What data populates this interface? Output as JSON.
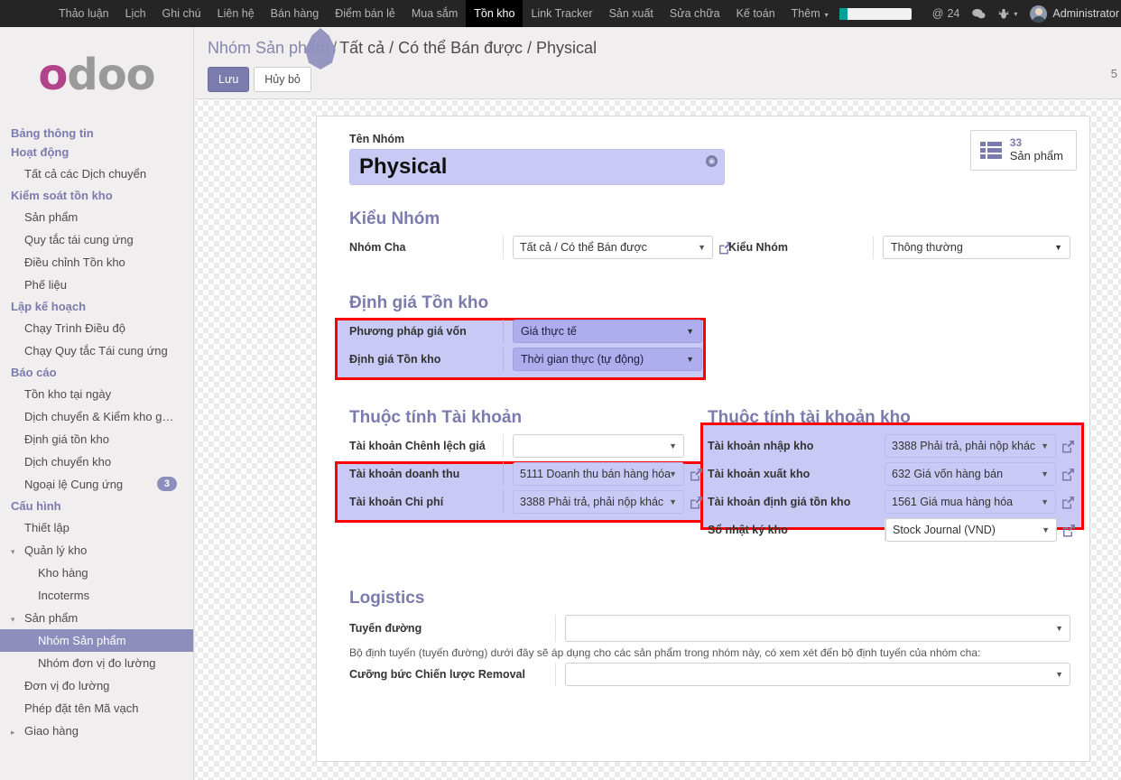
{
  "navbar": {
    "apps": [
      {
        "label": "Thảo luận",
        "active": false
      },
      {
        "label": "Lịch",
        "active": false
      },
      {
        "label": "Ghi chú",
        "active": false
      },
      {
        "label": "Liên hệ",
        "active": false
      },
      {
        "label": "Bán hàng",
        "active": false
      },
      {
        "label": "Điểm bán lẻ",
        "active": false
      },
      {
        "label": "Mua sắm",
        "active": false
      },
      {
        "label": "Tồn kho",
        "active": true
      },
      {
        "label": "Link Tracker",
        "active": false
      },
      {
        "label": "Sản xuất",
        "active": false
      },
      {
        "label": "Sửa chữa",
        "active": false
      },
      {
        "label": "Kế toán",
        "active": false
      },
      {
        "label": "Thêm",
        "active": false,
        "caret": "▾"
      }
    ],
    "systray": {
      "progress_percent": 12,
      "mention_icon": "at-icon",
      "mention_label": "@",
      "mention_count": "24",
      "chat_icon": "chat-bubble-icon",
      "chat_glyph": "💬",
      "debug_icon": "bug-icon",
      "debug_glyph": "🐞",
      "debug_caret": "▾",
      "avatar_icon": "avatar",
      "user_name": "Administrator"
    }
  },
  "sidebar": {
    "logo": {
      "first": "o",
      "rest": "doo"
    },
    "groups": [
      {
        "title": "Bảng thông tin",
        "title2": "Hoạt động",
        "items": [
          {
            "label": "Tất cả các Dịch chuyển",
            "level": 1,
            "selected": false,
            "twist": "",
            "badge": ""
          }
        ]
      },
      {
        "title": "Kiểm soát tồn kho",
        "items": [
          {
            "label": "Sản phẩm",
            "level": 1,
            "selected": false,
            "twist": "",
            "badge": ""
          },
          {
            "label": "Quy tắc tái cung ứng",
            "level": 1,
            "selected": false,
            "twist": "",
            "badge": ""
          },
          {
            "label": "Điều chỉnh Tồn kho",
            "level": 1,
            "selected": false,
            "twist": "",
            "badge": ""
          },
          {
            "label": "Phế liệu",
            "level": 1,
            "selected": false,
            "twist": "",
            "badge": ""
          }
        ]
      },
      {
        "title": "Lập kế hoạch",
        "items": [
          {
            "label": "Chạy Trình Điều độ",
            "level": 1,
            "selected": false,
            "twist": "",
            "badge": ""
          },
          {
            "label": "Chạy Quy tắc Tái cung ứng",
            "level": 1,
            "selected": false,
            "twist": "",
            "badge": ""
          }
        ]
      },
      {
        "title": "Báo cáo",
        "items": [
          {
            "label": "Tồn kho tại ngày",
            "level": 1,
            "selected": false,
            "twist": "",
            "badge": ""
          },
          {
            "label": "Dịch chuyển & Kiểm kho g…",
            "level": 1,
            "selected": false,
            "twist": "",
            "badge": ""
          },
          {
            "label": "Định giá tồn kho",
            "level": 1,
            "selected": false,
            "twist": "",
            "badge": ""
          },
          {
            "label": "Dịch chuyển kho",
            "level": 1,
            "selected": false,
            "twist": "",
            "badge": ""
          },
          {
            "label": "Ngoại lệ Cung ứng",
            "level": 1,
            "selected": false,
            "twist": "",
            "badge": "3"
          }
        ]
      },
      {
        "title": "Cấu hình",
        "items": [
          {
            "label": "Thiết lập",
            "level": 1,
            "selected": false,
            "twist": "",
            "badge": ""
          },
          {
            "label": "Quản lý kho",
            "level": 1,
            "selected": false,
            "twist": "▾",
            "badge": ""
          },
          {
            "label": "Kho hàng",
            "level": 2,
            "selected": false,
            "twist": "",
            "badge": ""
          },
          {
            "label": "Incoterms",
            "level": 2,
            "selected": false,
            "twist": "",
            "badge": ""
          },
          {
            "label": "Sản phẩm",
            "level": 1,
            "selected": false,
            "twist": "▾",
            "badge": ""
          },
          {
            "label": "Nhóm Sản phẩm",
            "level": 2,
            "selected": true,
            "twist": "",
            "badge": ""
          },
          {
            "label": "Nhóm đơn vị đo lường",
            "level": 2,
            "selected": false,
            "twist": "",
            "badge": ""
          },
          {
            "label": "Đơn vị đo lường",
            "level": 1,
            "selected": false,
            "twist": "",
            "badge": ""
          },
          {
            "label": "Phép đặt tên Mã vạch",
            "level": 1,
            "selected": false,
            "twist": "",
            "badge": ""
          },
          {
            "label": "Giao hàng",
            "level": 1,
            "selected": false,
            "twist": "▸",
            "badge": ""
          }
        ]
      }
    ]
  },
  "control_panel": {
    "breadcrumb_root": "Nhóm Sản phẩm",
    "breadcrumb_sep": "/",
    "breadcrumb_current": "Tất cả / Có thể Bán được / Physical",
    "save_label": "Lưu",
    "discard_label": "Hủy bỏ",
    "pager": "5"
  },
  "form": {
    "title_label": "Tên Nhóm",
    "title_value": "Physical",
    "title_globe_icon": "globe-translate-icon",
    "stat_button": {
      "icon": "list-icon",
      "value": "33",
      "text": "Sản phẩm"
    },
    "group_type": {
      "title": "Kiểu Nhóm",
      "parent_label": "Nhóm Cha",
      "parent_value": "Tất cả / Có thể Bán được",
      "type_label": "Kiểu Nhóm",
      "type_value": "Thông thường"
    },
    "inventory_valuation": {
      "title": "Định giá Tồn kho",
      "costing_label": "Phương pháp giá vốn",
      "costing_value": "Giá thực tế",
      "valuation_label": "Định giá Tồn kho",
      "valuation_value": "Thời gian thực (tự động)"
    },
    "account_props": {
      "title": "Thuộc tính Tài khoản",
      "price_diff_label": "Tài khoản Chênh lệch giá",
      "price_diff_value": "",
      "income_label": "Tài khoản doanh thu",
      "income_value": "5111 Doanh thu bán hàng hóa",
      "expense_label": "Tài khoản Chi phí",
      "expense_value": "3388 Phải trả, phải nộp khác"
    },
    "stock_account_props": {
      "title": "Thuộc tính tài khoản kho",
      "input_label": "Tài khoản nhập kho",
      "input_value": "3388 Phải trả, phải nộp khác",
      "output_label": "Tài khoản xuất kho",
      "output_value": "632 Giá vốn hàng bán",
      "valuation_label": "Tài khoản định giá tồn kho",
      "valuation_value": "1561 Giá mua hàng hóa",
      "journal_label": "Sổ nhật ký kho",
      "journal_value": "Stock Journal (VND)"
    },
    "logistics": {
      "title": "Logistics",
      "routes_label": "Tuyến đường",
      "routes_value": "",
      "note": "Bộ định tuyến (tuyến đường) dưới đây sẽ áp dụng cho các sản phẩm trong nhóm này, có xem xét đến bộ định tuyến của nhóm cha:",
      "removal_label": "Cưỡng bức Chiến lược Removal",
      "removal_value": ""
    }
  },
  "colors": {
    "brand_purple": "#7c7bad",
    "highlight_lavender": "#c9c9f5",
    "annotation_red": "#ff0000",
    "navbar_dark": "#252525",
    "logo_magenta": "#b2448c"
  }
}
